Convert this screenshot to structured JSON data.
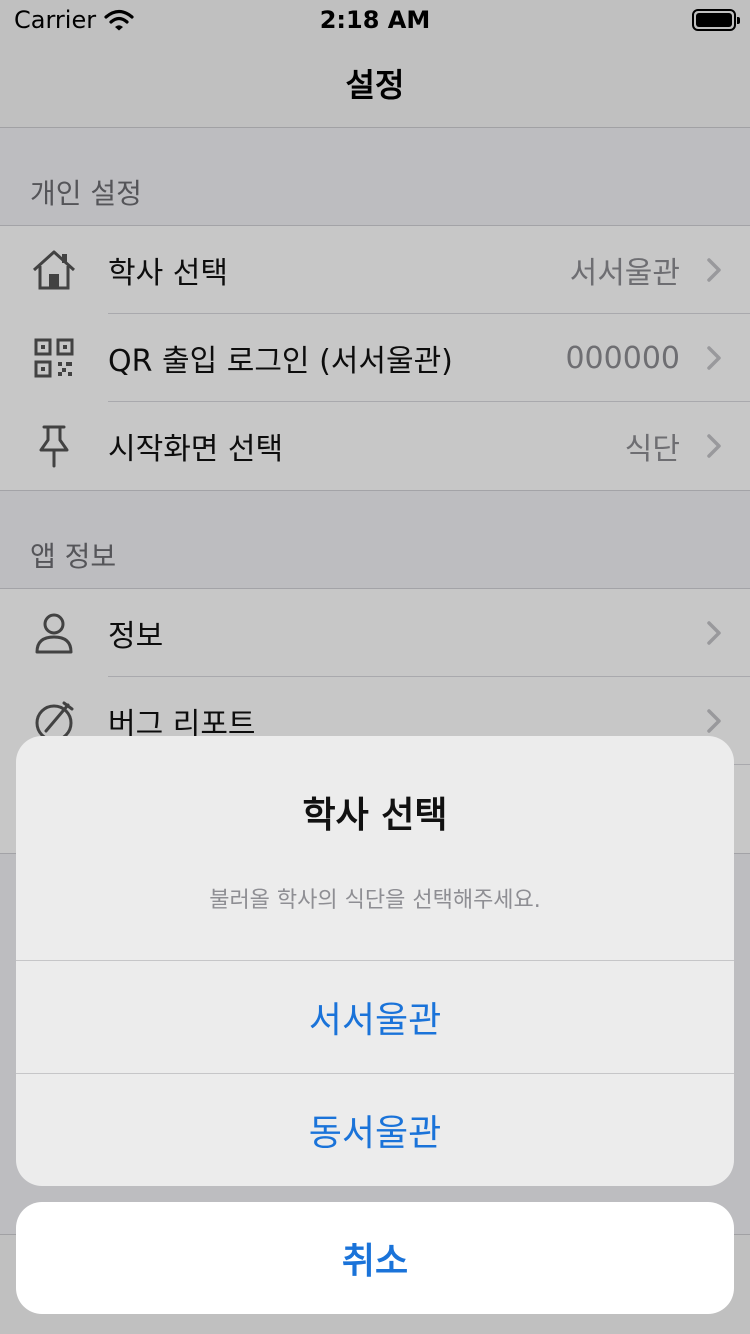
{
  "status": {
    "carrier": "Carrier",
    "time": "2:18 AM"
  },
  "nav": {
    "title": "설정"
  },
  "sections": [
    {
      "header": "개인 설정",
      "rows": [
        {
          "icon": "house-icon",
          "label": "학사 선택",
          "value": "서서울관"
        },
        {
          "icon": "qr-code-icon",
          "label": "QR 출입 로그인 (서서울관)",
          "value": "000000"
        },
        {
          "icon": "pin-icon",
          "label": "시작화면 선택",
          "value": "식단"
        }
      ]
    },
    {
      "header": "앱 정보",
      "rows": [
        {
          "icon": "person-icon",
          "label": "정보",
          "value": ""
        },
        {
          "icon": "bug-report-icon",
          "label": "버그 리포트",
          "value": ""
        }
      ]
    }
  ],
  "tabbar": {
    "active_color": "#1a73d9"
  },
  "action_sheet": {
    "title": "학사 선택",
    "message": "불러올 학사의 식단을 선택해주세요.",
    "options": [
      "서서울관",
      "동서울관"
    ],
    "cancel": "취소"
  },
  "colors": {
    "accent": "#1a73d9",
    "secondary_text": "#8e8e93"
  }
}
